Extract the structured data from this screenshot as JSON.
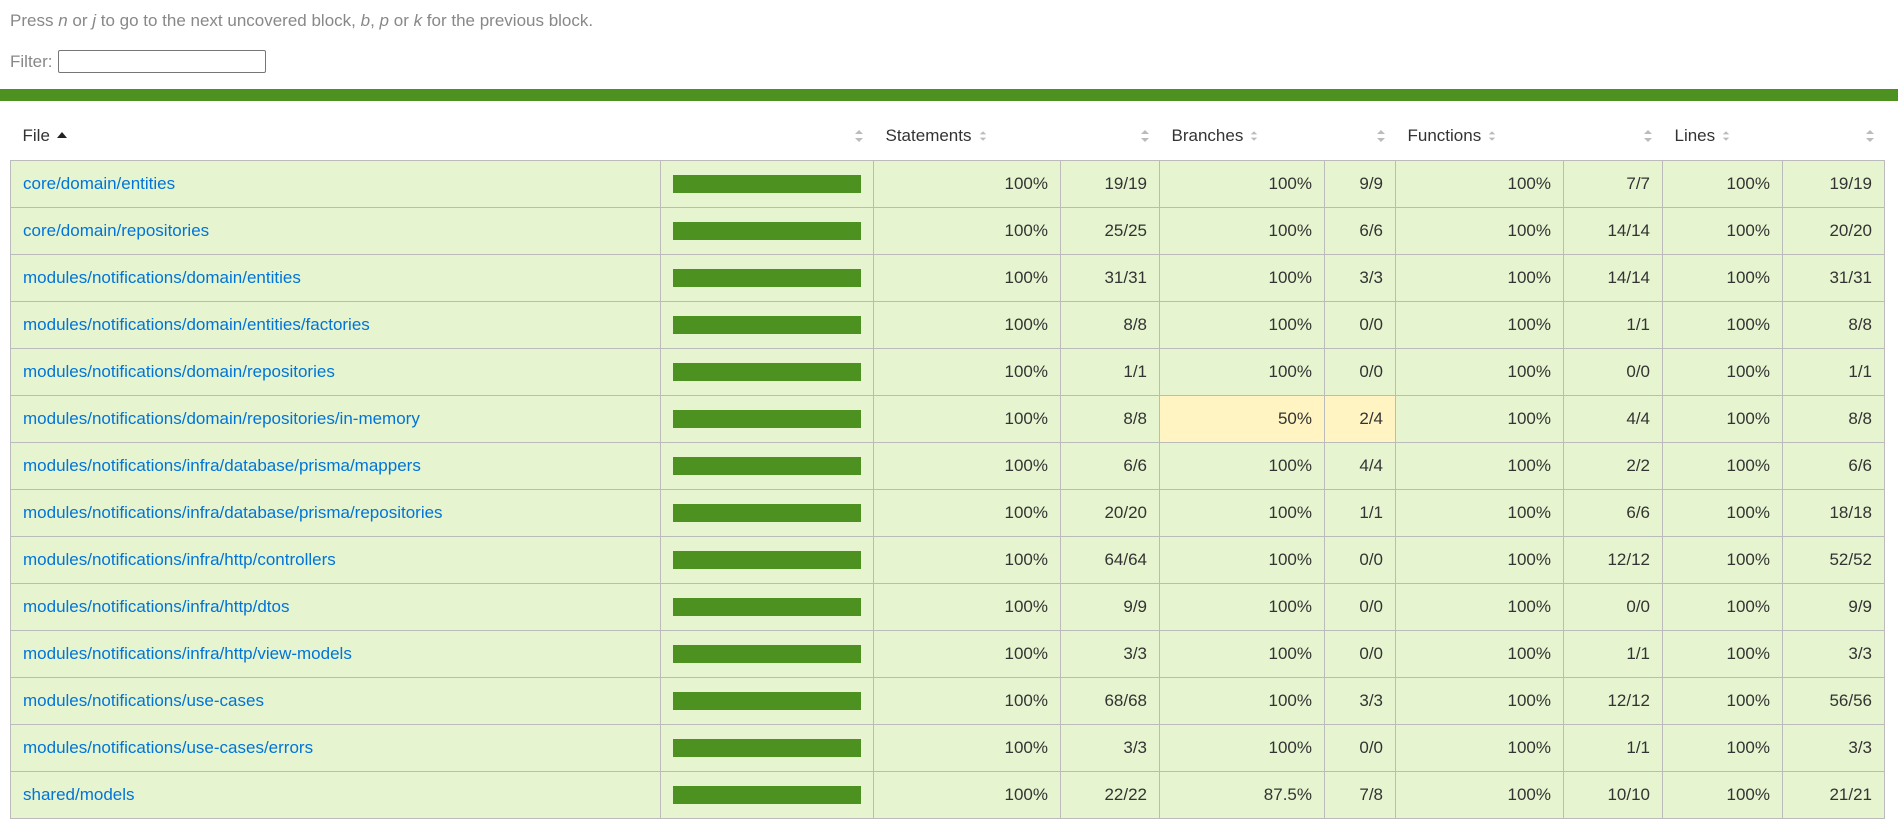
{
  "hint": {
    "prefix": "Press ",
    "k1": "n",
    "or1": " or ",
    "k2": "j",
    "mid": " to go to the next uncovered block, ",
    "k3": "b",
    "comma": ", ",
    "k4": "p",
    "or2": " or ",
    "k5": "k",
    "suffix": " for the previous block."
  },
  "filter": {
    "label": "Filter:",
    "value": ""
  },
  "colors": {
    "high_row": "#e6f5d0",
    "medium_cell": "#fff4c2",
    "bar": "#4d9221",
    "link": "#0074d9"
  },
  "headers": {
    "file": "File",
    "statements": "Statements",
    "branches": "Branches",
    "functions": "Functions",
    "lines": "Lines"
  },
  "rows": [
    {
      "file": "core/domain/entities",
      "coverage": 1.0,
      "stmt_pct": "100%",
      "stmt_abs": "19/19",
      "br_pct": "100%",
      "br_abs": "9/9",
      "fn_pct": "100%",
      "fn_abs": "7/7",
      "ln_pct": "100%",
      "ln_abs": "19/19"
    },
    {
      "file": "core/domain/repositories",
      "coverage": 1.0,
      "stmt_pct": "100%",
      "stmt_abs": "25/25",
      "br_pct": "100%",
      "br_abs": "6/6",
      "fn_pct": "100%",
      "fn_abs": "14/14",
      "ln_pct": "100%",
      "ln_abs": "20/20"
    },
    {
      "file": "modules/notifications/domain/entities",
      "coverage": 1.0,
      "stmt_pct": "100%",
      "stmt_abs": "31/31",
      "br_pct": "100%",
      "br_abs": "3/3",
      "fn_pct": "100%",
      "fn_abs": "14/14",
      "ln_pct": "100%",
      "ln_abs": "31/31"
    },
    {
      "file": "modules/notifications/domain/entities/factories",
      "coverage": 1.0,
      "stmt_pct": "100%",
      "stmt_abs": "8/8",
      "br_pct": "100%",
      "br_abs": "0/0",
      "fn_pct": "100%",
      "fn_abs": "1/1",
      "ln_pct": "100%",
      "ln_abs": "8/8"
    },
    {
      "file": "modules/notifications/domain/repositories",
      "coverage": 1.0,
      "stmt_pct": "100%",
      "stmt_abs": "1/1",
      "br_pct": "100%",
      "br_abs": "0/0",
      "fn_pct": "100%",
      "fn_abs": "0/0",
      "ln_pct": "100%",
      "ln_abs": "1/1"
    },
    {
      "file": "modules/notifications/domain/repositories/in-memory",
      "coverage": 1.0,
      "stmt_pct": "100%",
      "stmt_abs": "8/8",
      "br_pct": "50%",
      "br_abs": "2/4",
      "br_medium": true,
      "fn_pct": "100%",
      "fn_abs": "4/4",
      "ln_pct": "100%",
      "ln_abs": "8/8"
    },
    {
      "file": "modules/notifications/infra/database/prisma/mappers",
      "coverage": 1.0,
      "stmt_pct": "100%",
      "stmt_abs": "6/6",
      "br_pct": "100%",
      "br_abs": "4/4",
      "fn_pct": "100%",
      "fn_abs": "2/2",
      "ln_pct": "100%",
      "ln_abs": "6/6"
    },
    {
      "file": "modules/notifications/infra/database/prisma/repositories",
      "coverage": 1.0,
      "stmt_pct": "100%",
      "stmt_abs": "20/20",
      "br_pct": "100%",
      "br_abs": "1/1",
      "fn_pct": "100%",
      "fn_abs": "6/6",
      "ln_pct": "100%",
      "ln_abs": "18/18"
    },
    {
      "file": "modules/notifications/infra/http/controllers",
      "coverage": 1.0,
      "stmt_pct": "100%",
      "stmt_abs": "64/64",
      "br_pct": "100%",
      "br_abs": "0/0",
      "fn_pct": "100%",
      "fn_abs": "12/12",
      "ln_pct": "100%",
      "ln_abs": "52/52"
    },
    {
      "file": "modules/notifications/infra/http/dtos",
      "coverage": 1.0,
      "stmt_pct": "100%",
      "stmt_abs": "9/9",
      "br_pct": "100%",
      "br_abs": "0/0",
      "fn_pct": "100%",
      "fn_abs": "0/0",
      "ln_pct": "100%",
      "ln_abs": "9/9"
    },
    {
      "file": "modules/notifications/infra/http/view-models",
      "coverage": 1.0,
      "stmt_pct": "100%",
      "stmt_abs": "3/3",
      "br_pct": "100%",
      "br_abs": "0/0",
      "fn_pct": "100%",
      "fn_abs": "1/1",
      "ln_pct": "100%",
      "ln_abs": "3/3"
    },
    {
      "file": "modules/notifications/use-cases",
      "coverage": 1.0,
      "stmt_pct": "100%",
      "stmt_abs": "68/68",
      "br_pct": "100%",
      "br_abs": "3/3",
      "fn_pct": "100%",
      "fn_abs": "12/12",
      "ln_pct": "100%",
      "ln_abs": "56/56"
    },
    {
      "file": "modules/notifications/use-cases/errors",
      "coverage": 1.0,
      "stmt_pct": "100%",
      "stmt_abs": "3/3",
      "br_pct": "100%",
      "br_abs": "0/0",
      "fn_pct": "100%",
      "fn_abs": "1/1",
      "ln_pct": "100%",
      "ln_abs": "3/3"
    },
    {
      "file": "shared/models",
      "coverage": 1.0,
      "stmt_pct": "100%",
      "stmt_abs": "22/22",
      "br_pct": "87.5%",
      "br_abs": "7/8",
      "fn_pct": "100%",
      "fn_abs": "10/10",
      "ln_pct": "100%",
      "ln_abs": "21/21"
    }
  ]
}
